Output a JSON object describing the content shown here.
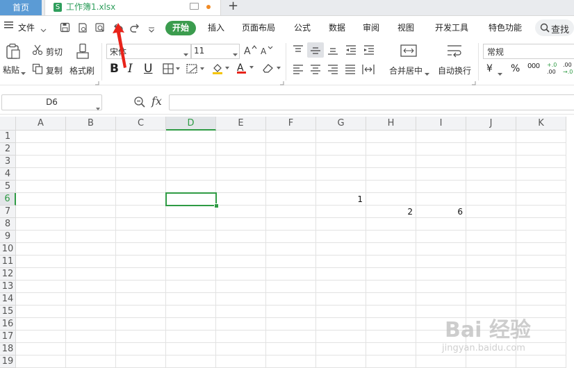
{
  "tabs": {
    "home": "首页",
    "file": "工作簿1.xlsx",
    "file_badge": "S",
    "add": "+"
  },
  "menu": {
    "file": "文件",
    "start": "开始",
    "items": [
      "插入",
      "页面布局",
      "公式",
      "数据",
      "审阅",
      "视图",
      "开发工具",
      "特色功能"
    ],
    "search": "查找"
  },
  "toolbar": {
    "paste": "粘贴",
    "cut": "剪切",
    "copy": "复制",
    "format_painter": "格式刷",
    "font_name": "宋体",
    "font_size": "11",
    "bold": "B",
    "italic": "I",
    "underline": "U",
    "merge_center": "合并居中",
    "wrap_text": "自动换行",
    "number_format": "常规",
    "currency": "¥",
    "percent": "%",
    "thousands": "000",
    "inc_decimal": "+.0\n.00",
    "dec_decimal": ".00\n→.0"
  },
  "formula_bar": {
    "name_box": "D6",
    "fx": "fx",
    "value": ""
  },
  "grid": {
    "columns": [
      "A",
      "B",
      "C",
      "D",
      "E",
      "F",
      "G",
      "H",
      "I",
      "J",
      "K"
    ],
    "rows": [
      "1",
      "2",
      "3",
      "4",
      "5",
      "6",
      "7",
      "8",
      "9",
      "10",
      "11",
      "12",
      "13",
      "14",
      "15",
      "16",
      "17",
      "18",
      "19"
    ],
    "selected_cell": "D6",
    "cells": [
      {
        "ref": "G6",
        "value": "1"
      },
      {
        "ref": "H7",
        "value": "2"
      },
      {
        "ref": "I7",
        "value": "6"
      }
    ]
  },
  "colors": {
    "accent": "#3b9c4e",
    "selection": "#2e9b44",
    "annotation": "#e8231a",
    "home_tab": "#5b9bd5"
  },
  "watermark": {
    "brand": "Bai 经验",
    "url": "jingyan.baidu.com"
  }
}
